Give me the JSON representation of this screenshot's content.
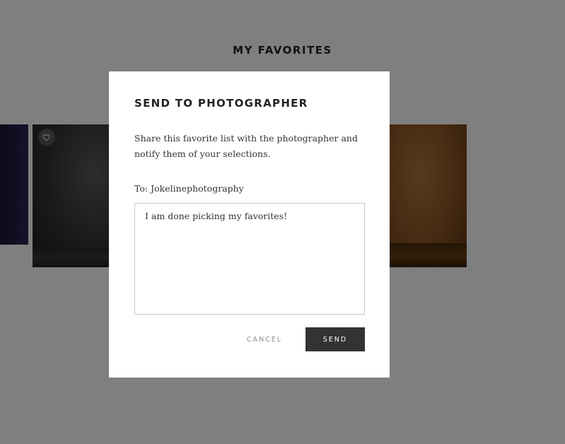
{
  "page": {
    "title": "MY FAVORITES"
  },
  "gallery": {
    "photos": [
      {
        "name": "photo-dark-blue-backdrop",
        "favorite_icon": "heart-outline-icon"
      },
      {
        "name": "photo-dark-gray-backdrop",
        "favorite_icon": "heart-outline-icon"
      },
      {
        "name": "photo-brown-backdrop",
        "favorite_icon": "heart-outline-icon"
      }
    ]
  },
  "modal": {
    "title": "SEND TO PHOTOGRAPHER",
    "description": "Share this favorite list with the photographer and notify them of your selections.",
    "to_prefix": "To:",
    "to_recipient": "Jokelinephotography",
    "message": "I am done picking my favorites!",
    "cancel_label": "CANCEL",
    "send_label": "SEND"
  },
  "colors": {
    "overlay": "rgba(0,0,0,0.5)",
    "send_button_bg": "#333333",
    "cancel_text": "#8a8a8a",
    "text": "#333333"
  }
}
